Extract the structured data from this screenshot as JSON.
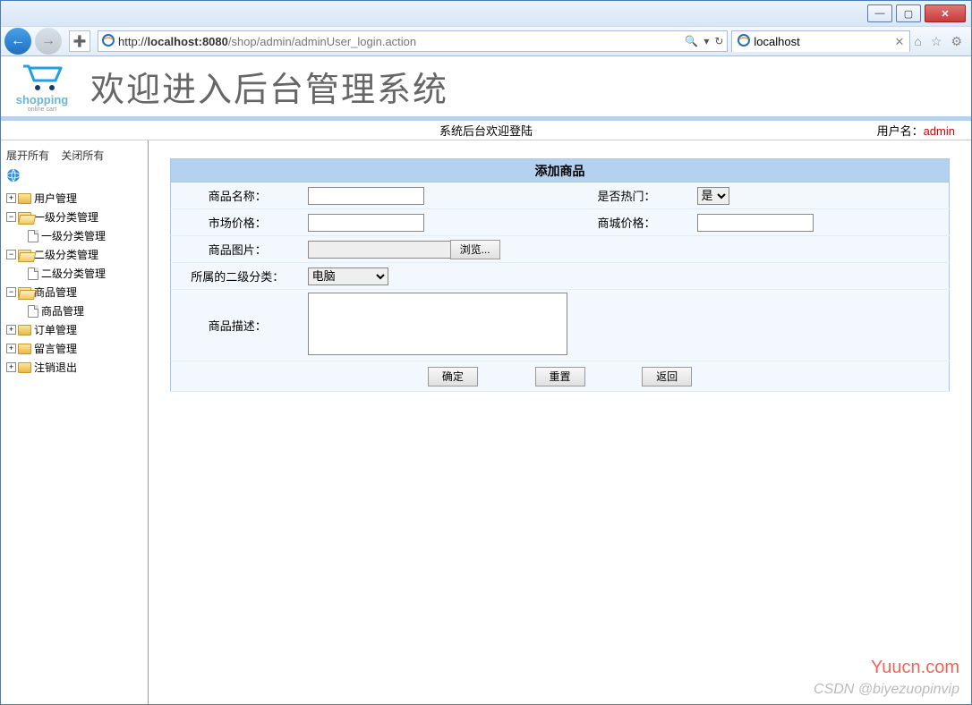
{
  "browser": {
    "url_pre": "http://",
    "url_host": "localhost",
    "url_port": ":8080",
    "url_rest": "/shop/admin/adminUser_login.action",
    "tab_title": "localhost",
    "search_hint": "🔍",
    "refresh_hint": "↻"
  },
  "header": {
    "logo_text": "shopping",
    "logo_sub": "online cart",
    "title": "欢迎进入后台管理系统"
  },
  "subheader": {
    "center": "系统后台欢迎登陆",
    "user_label": "用户名：",
    "user": "admin"
  },
  "sidebar": {
    "expand": "展开所有",
    "collapse": "关闭所有",
    "items": [
      {
        "label": "用户管理",
        "level": 1,
        "toggle": "+",
        "folder": true,
        "open": false
      },
      {
        "label": "一级分类管理",
        "level": 1,
        "toggle": "−",
        "folder": true,
        "open": true
      },
      {
        "label": "一级分类管理",
        "level": 2,
        "page": true
      },
      {
        "label": "二级分类管理",
        "level": 1,
        "toggle": "−",
        "folder": true,
        "open": true
      },
      {
        "label": "二级分类管理",
        "level": 2,
        "page": true
      },
      {
        "label": "商品管理",
        "level": 1,
        "toggle": "−",
        "folder": true,
        "open": true
      },
      {
        "label": "商品管理",
        "level": 2,
        "page": true
      },
      {
        "label": "订单管理",
        "level": 1,
        "toggle": "+",
        "folder": true,
        "open": false
      },
      {
        "label": "留言管理",
        "level": 1,
        "toggle": "+",
        "folder": true,
        "open": false
      },
      {
        "label": "注销退出",
        "level": 1,
        "toggle": "+",
        "folder": true,
        "open": false
      }
    ]
  },
  "form": {
    "title": "添加商品",
    "name_label": "商品名称：",
    "hot_label": "是否热门：",
    "hot_value": "是",
    "market_price_label": "市场价格：",
    "mall_price_label": "商城价格：",
    "image_label": "商品图片：",
    "browse_btn": "浏览...",
    "category_label": "所属的二级分类：",
    "category_value": "电脑",
    "desc_label": "商品描述：",
    "submit": "确定",
    "reset": "重置",
    "back": "返回"
  },
  "watermark": {
    "w1": "Yuucn.com",
    "w2": "CSDN @biyezuopinvip"
  }
}
